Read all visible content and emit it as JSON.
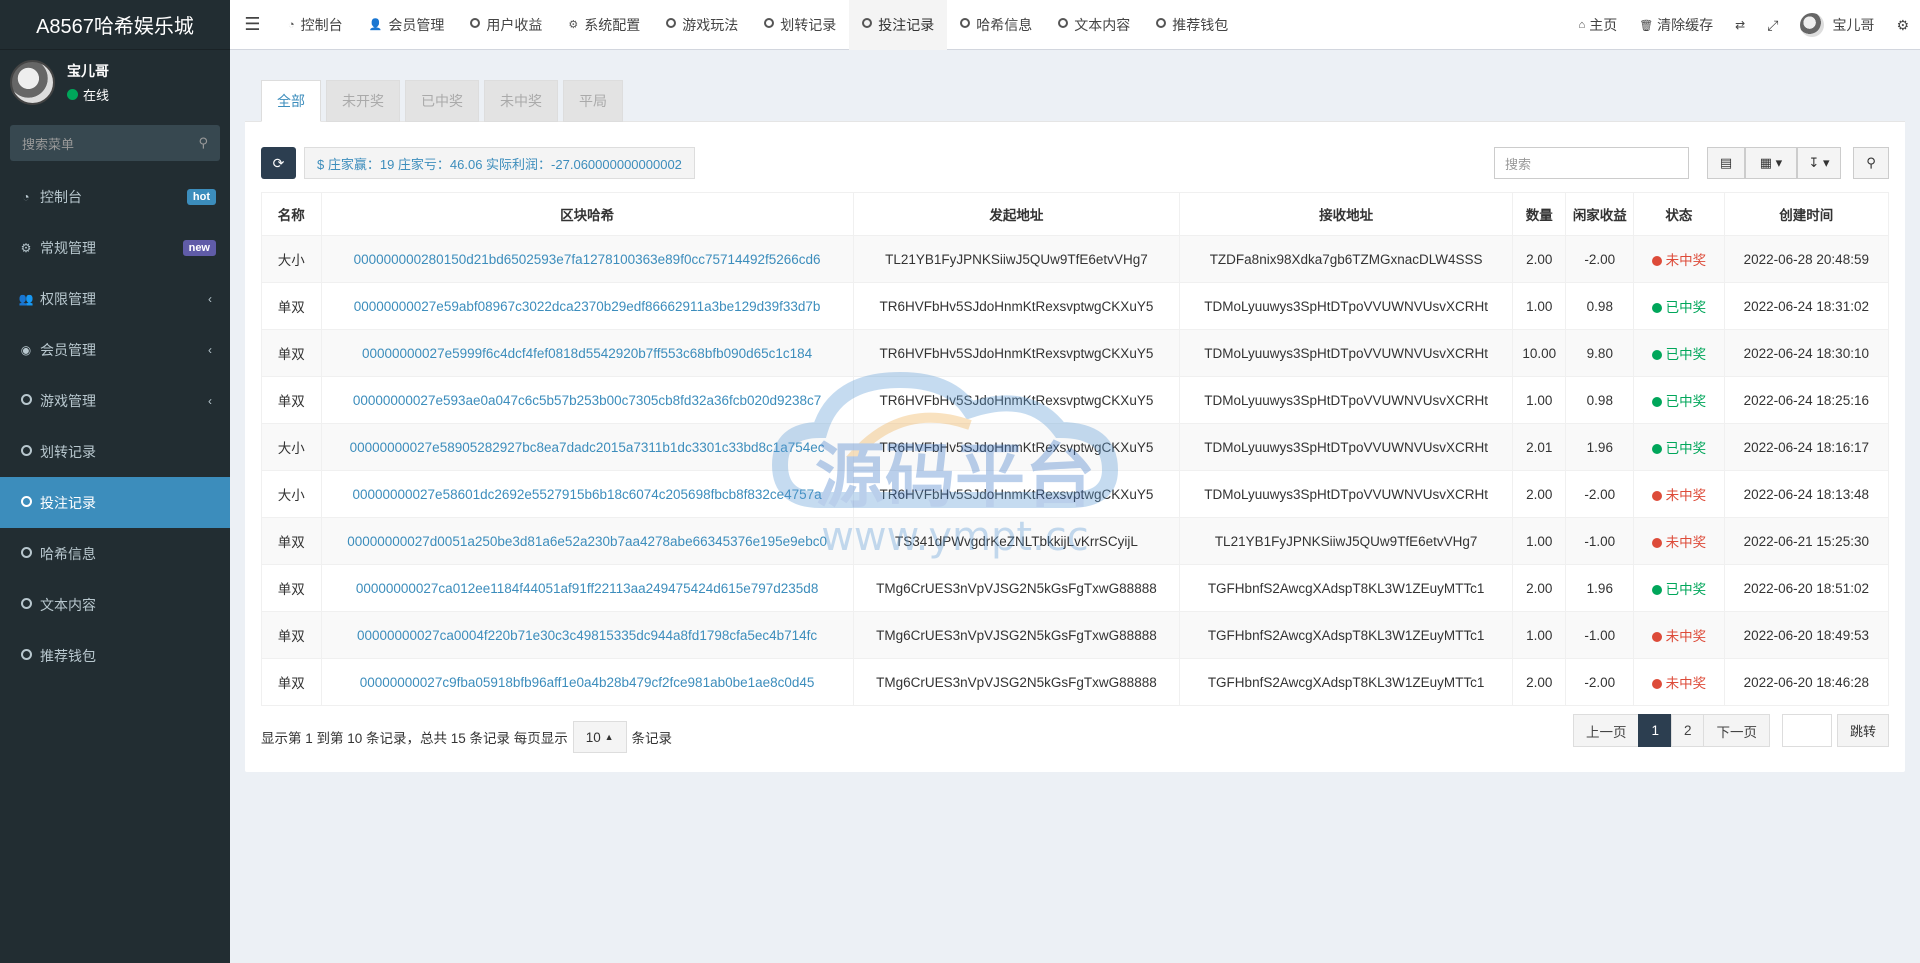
{
  "app": {
    "title": "A8567哈希娱乐城"
  },
  "user": {
    "name": "宝儿哥",
    "status": "在线"
  },
  "sidebar": {
    "search_placeholder": "搜索菜单",
    "items": [
      {
        "label": "控制台",
        "icon": "dashboard-icon",
        "badge": "hot"
      },
      {
        "label": "常规管理",
        "icon": "cogs-icon",
        "badge": "new"
      },
      {
        "label": "权限管理",
        "icon": "group-icon",
        "chevron": "‹"
      },
      {
        "label": "会员管理",
        "icon": "user-circle-icon",
        "chevron": "‹"
      },
      {
        "label": "游戏管理",
        "icon": "circle-icon",
        "chevron": "‹"
      },
      {
        "label": "划转记录",
        "icon": "circle-icon"
      },
      {
        "label": "投注记录",
        "icon": "circle-icon",
        "active": true
      },
      {
        "label": "哈希信息",
        "icon": "circle-icon"
      },
      {
        "label": "文本内容",
        "icon": "circle-icon"
      },
      {
        "label": "推荐钱包",
        "icon": "circle-icon"
      }
    ]
  },
  "navbar": {
    "tabs": [
      {
        "label": "控制台",
        "icon": "dashboard-icon"
      },
      {
        "label": "会员管理",
        "icon": "user-icon"
      },
      {
        "label": "用户收益",
        "icon": "circle-icon"
      },
      {
        "label": "系统配置",
        "icon": "gear-icon"
      },
      {
        "label": "游戏玩法",
        "icon": "circle-icon"
      },
      {
        "label": "划转记录",
        "icon": "circle-icon"
      },
      {
        "label": "投注记录",
        "icon": "circle-icon",
        "active": true
      },
      {
        "label": "哈希信息",
        "icon": "circle-icon"
      },
      {
        "label": "文本内容",
        "icon": "circle-icon"
      },
      {
        "label": "推荐钱包",
        "icon": "circle-icon"
      }
    ],
    "home": "主页",
    "clear_cache": "清除缓存",
    "username": "宝儿哥"
  },
  "status_tabs": [
    "全部",
    "未开奖",
    "已中奖",
    "未中奖",
    "平局"
  ],
  "stats_text": "$ 庄家赢：19 庄家亏：46.06 实际利润：-27.060000000000002",
  "search_placeholder": "搜索",
  "table": {
    "headers": [
      "名称",
      "区块哈希",
      "发起地址",
      "接收地址",
      "数量",
      "闲家收益",
      "状态",
      "创建时间"
    ],
    "rows": [
      [
        "大小",
        "000000000280150d21bd6502593e7fa1278100363e89f0cc75714492f5266cd6",
        "TL21YB1FyJPNKSiiwJ5QUw9TfE6etvVHg7",
        "TZDFa8nix98Xdka7gb6TZMGxnacDLW4SSS",
        "2.00",
        "-2.00",
        "未中奖",
        "2022-06-28 20:48:59"
      ],
      [
        "单双",
        "00000000027e59abf08967c3022dca2370b29edf86662911a3be129d39f33d7b",
        "TR6HVFbHv5SJdoHnmKtRexsvptwgCKXuY5",
        "TDMoLyuuwys3SpHtDTpoVVUWNVUsvXCRHt",
        "1.00",
        "0.98",
        "已中奖",
        "2022-06-24 18:31:02"
      ],
      [
        "单双",
        "00000000027e5999f6c4dcf4fef0818d5542920b7ff553c68bfb090d65c1c184",
        "TR6HVFbHv5SJdoHnmKtRexsvptwgCKXuY5",
        "TDMoLyuuwys3SpHtDTpoVVUWNVUsvXCRHt",
        "10.00",
        "9.80",
        "已中奖",
        "2022-06-24 18:30:10"
      ],
      [
        "单双",
        "00000000027e593ae0a047c6c5b57b253b00c7305cb8fd32a36fcb020d9238c7",
        "TR6HVFbHv5SJdoHnmKtRexsvptwgCKXuY5",
        "TDMoLyuuwys3SpHtDTpoVVUWNVUsvXCRHt",
        "1.00",
        "0.98",
        "已中奖",
        "2022-06-24 18:25:16"
      ],
      [
        "大小",
        "00000000027e58905282927bc8ea7dadc2015a7311b1dc3301c33bd8c1a754ec",
        "TR6HVFbHv5SJdoHnmKtRexsvptwgCKXuY5",
        "TDMoLyuuwys3SpHtDTpoVVUWNVUsvXCRHt",
        "2.01",
        "1.96",
        "已中奖",
        "2022-06-24 18:16:17"
      ],
      [
        "大小",
        "00000000027e58601dc2692e5527915b6b18c6074c205698fbcb8f832ce4757a",
        "TR6HVFbHv5SJdoHnmKtRexsvptwgCKXuY5",
        "TDMoLyuuwys3SpHtDTpoVVUWNVUsvXCRHt",
        "2.00",
        "-2.00",
        "未中奖",
        "2022-06-24 18:13:48"
      ],
      [
        "单双",
        "00000000027d0051a250be3d81a6e52a230b7aa4278abe66345376e195e9ebc0",
        "TS341dPWvgdrKeZNLTbkkijLvKrrSCyijL",
        "TL21YB1FyJPNKSiiwJ5QUw9TfE6etvVHg7",
        "1.00",
        "-1.00",
        "未中奖",
        "2022-06-21 15:25:30"
      ],
      [
        "单双",
        "00000000027ca012ee1184f44051af91ff22113aa249475424d615e797d235d8",
        "TMg6CrUES3nVpVJSG2N5kGsFgTxwG88888",
        "TGFHbnfS2AwcgXAdspT8KL3W1ZEuyMTTc1",
        "2.00",
        "1.96",
        "已中奖",
        "2022-06-20 18:51:02"
      ],
      [
        "单双",
        "00000000027ca0004f220b71e30c3c49815335dc944a8fd1798cfa5ec4b714fc",
        "TMg6CrUES3nVpVJSG2N5kGsFgTxwG88888",
        "TGFHbnfS2AwcgXAdspT8KL3W1ZEuyMTTc1",
        "1.00",
        "-1.00",
        "未中奖",
        "2022-06-20 18:49:53"
      ],
      [
        "单双",
        "00000000027c9fba05918bfb96aff1e0a4b28b479cf2fce981ab0be1ae8c0d45",
        "TMg6CrUES3nVpVJSG2N5kGsFgTxwG88888",
        "TGFHbnfS2AwcgXAdspT8KL3W1ZEuyMTTc1",
        "2.00",
        "-2.00",
        "未中奖",
        "2022-06-20 18:46:28"
      ]
    ]
  },
  "footer": {
    "info": "显示第 1 到第 10 条记录，总共 15 条记录 每页显示",
    "page_size": "10",
    "suffix": "条记录"
  },
  "pagination": {
    "prev": "上一页",
    "pages": [
      "1",
      "2"
    ],
    "current": "1",
    "next": "下一页",
    "jump": "跳转"
  },
  "watermark": {
    "title": "源码平台",
    "url": "www.ympt.cc"
  },
  "colors": {
    "sidebar_bg": "#222d32",
    "accent": "#3c8dbc",
    "win": "#00a65a",
    "lose": "#dd4b39"
  }
}
